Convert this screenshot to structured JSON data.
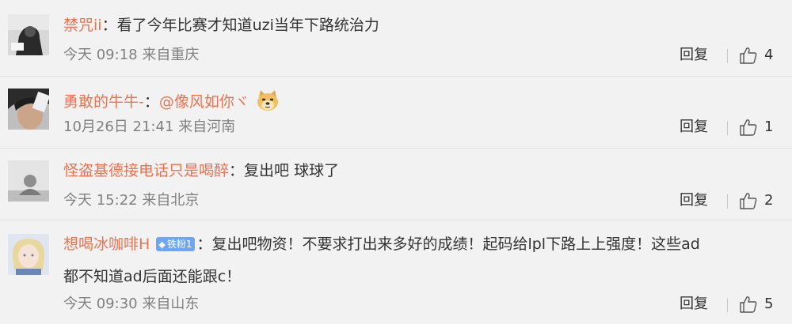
{
  "comments": [
    {
      "username": "禁咒ii",
      "colon": "：",
      "text": "看了今年比赛才知道uzi当年下路统治力",
      "time": "今天 09:18",
      "source": "来自重庆",
      "reply_label": "回复",
      "likes": "4"
    },
    {
      "username": "勇敢的牛牛-",
      "colon": "：",
      "mention": "@像风如你ヾ",
      "emoji_name": "doge-emoji",
      "time": "10月26日 21:41",
      "source": "来自河南",
      "reply_label": "回复",
      "likes": "1"
    },
    {
      "username": "怪盗基德接电话只是喝醉",
      "colon": "：",
      "text": "复出吧 球球了",
      "time": "今天 15:22",
      "source": "来自北京",
      "reply_label": "回复",
      "likes": "2"
    },
    {
      "username": "想喝冰咖啡H",
      "badge": "铁粉1",
      "colon": "：",
      "text": "复出吧物资！不要求打出来多好的成绩！起码给lpl下路上上强度！这些ad",
      "text2": "都不知道ad后面还能跟c！",
      "time": "今天 09:30",
      "source": "来自山东",
      "reply_label": "回复",
      "likes": "5"
    }
  ],
  "colors": {
    "username": "#eb7350",
    "meta": "#808080",
    "background": "#f2f2f2",
    "badge": "#6fa6f2"
  }
}
